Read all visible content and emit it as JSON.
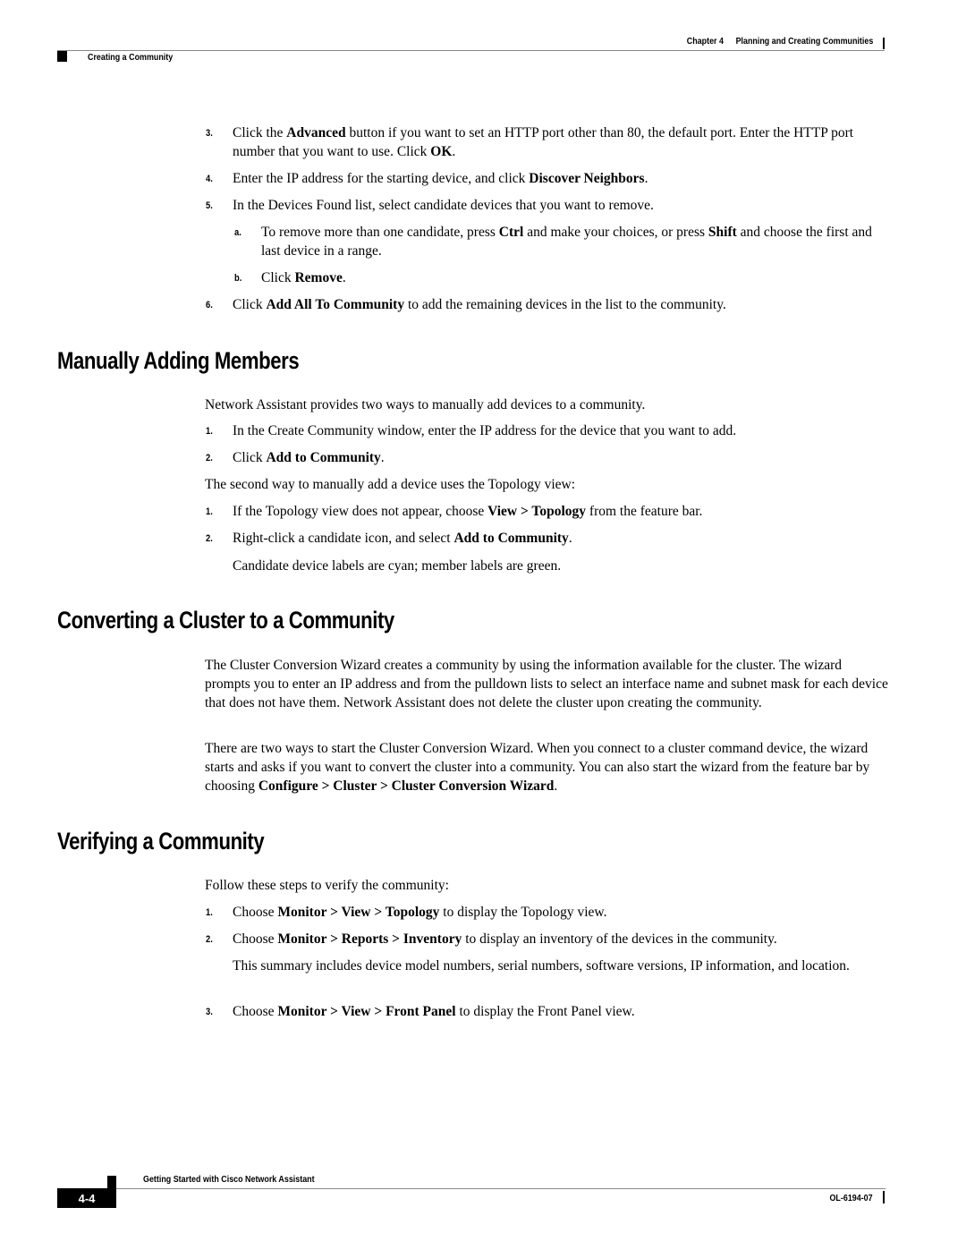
{
  "header": {
    "chapter_label": "Chapter 4",
    "chapter_title": "Planning and Creating Communities",
    "section": "Creating a Community"
  },
  "continued_steps": [
    {
      "num": "3.",
      "parts": [
        {
          "t": "Click the "
        },
        {
          "b": "Advanced"
        },
        {
          "t": " button if you want to set an HTTP port other than 80, the default port. Enter the HTTP port number that you want to use. Click "
        },
        {
          "b": "OK"
        },
        {
          "t": "."
        }
      ]
    },
    {
      "num": "4.",
      "parts": [
        {
          "t": "Enter the IP address for the starting device, and click "
        },
        {
          "b": "Discover Neighbors"
        },
        {
          "t": "."
        }
      ]
    },
    {
      "num": "5.",
      "parts": [
        {
          "t": "In the Devices Found list, select candidate devices that you want to remove."
        }
      ]
    },
    {
      "num": "a.",
      "sub": true,
      "parts": [
        {
          "t": "To remove more than one candidate, press "
        },
        {
          "b": "Ctrl"
        },
        {
          "t": " and make your choices, or press "
        },
        {
          "b": "Shift"
        },
        {
          "t": " and choose the first and last device in a range."
        }
      ]
    },
    {
      "num": "b.",
      "sub": true,
      "parts": [
        {
          "t": "Click "
        },
        {
          "b": "Remove"
        },
        {
          "t": "."
        }
      ]
    },
    {
      "num": "6.",
      "parts": [
        {
          "t": "Click "
        },
        {
          "b": "Add All To Community"
        },
        {
          "t": " to add the remaining devices in the list to the community."
        }
      ]
    }
  ],
  "sections": {
    "manual": {
      "heading": "Manually Adding Members",
      "intro": "Network Assistant provides two ways to manually add devices to a community.",
      "steps_a": [
        {
          "num": "1.",
          "parts": [
            {
              "t": "In the Create Community window, enter the IP address for the device that you want to add."
            }
          ]
        },
        {
          "num": "2.",
          "parts": [
            {
              "t": "Click "
            },
            {
              "b": "Add to Community"
            },
            {
              "t": "."
            }
          ]
        }
      ],
      "second_way": "The second way to manually add a device uses the Topology view:",
      "steps_b": [
        {
          "num": "1.",
          "parts": [
            {
              "t": "If the Topology view does not appear, choose "
            },
            {
              "b": "View > Topology"
            },
            {
              "t": " from the feature bar."
            }
          ]
        },
        {
          "num": "2.",
          "parts": [
            {
              "t": "Right-click a candidate icon, and select "
            },
            {
              "b": "Add to Community"
            },
            {
              "t": "."
            }
          ]
        }
      ],
      "note": "Candidate device labels are cyan; member labels are green."
    },
    "convert": {
      "heading": "Converting a Cluster to a Community",
      "para1": "The Cluster Conversion Wizard creates a community by using the information available for the cluster. The wizard prompts you to enter an IP address and from the pulldown lists to select an interface name and subnet mask for each device that does not have them. Network Assistant does not delete the cluster upon creating the community.",
      "para2_parts": [
        {
          "t": "There are two ways to start the Cluster Conversion Wizard. When you connect to a cluster command device, the wizard starts and asks if you want to convert the cluster into a community. You can also start the wizard from the feature bar by choosing "
        },
        {
          "b": "Configure > Cluster > Cluster Conversion Wizard"
        },
        {
          "t": "."
        }
      ]
    },
    "verify": {
      "heading": "Verifying a Community",
      "intro": "Follow these steps to verify the community:",
      "steps": [
        {
          "num": "1.",
          "parts": [
            {
              "t": "Choose "
            },
            {
              "b": "Monitor > View > Topology"
            },
            {
              "t": " to display the Topology view."
            }
          ]
        },
        {
          "num": "2.",
          "parts": [
            {
              "t": "Choose "
            },
            {
              "b": "Monitor > Reports > Inventory"
            },
            {
              "t": " to display an inventory of the devices in the community."
            }
          ]
        },
        {
          "num": "3.",
          "parts": [
            {
              "t": "Choose "
            },
            {
              "b": "Monitor > View > Front Panel"
            },
            {
              "t": " to display the Front Panel view."
            }
          ]
        }
      ],
      "note": "This summary includes device model numbers, serial numbers, software versions, IP information, and location."
    }
  },
  "footer": {
    "book_title": "Getting Started with Cisco Network Assistant",
    "page_number": "4-4",
    "doc_number": "OL-6194-07"
  }
}
